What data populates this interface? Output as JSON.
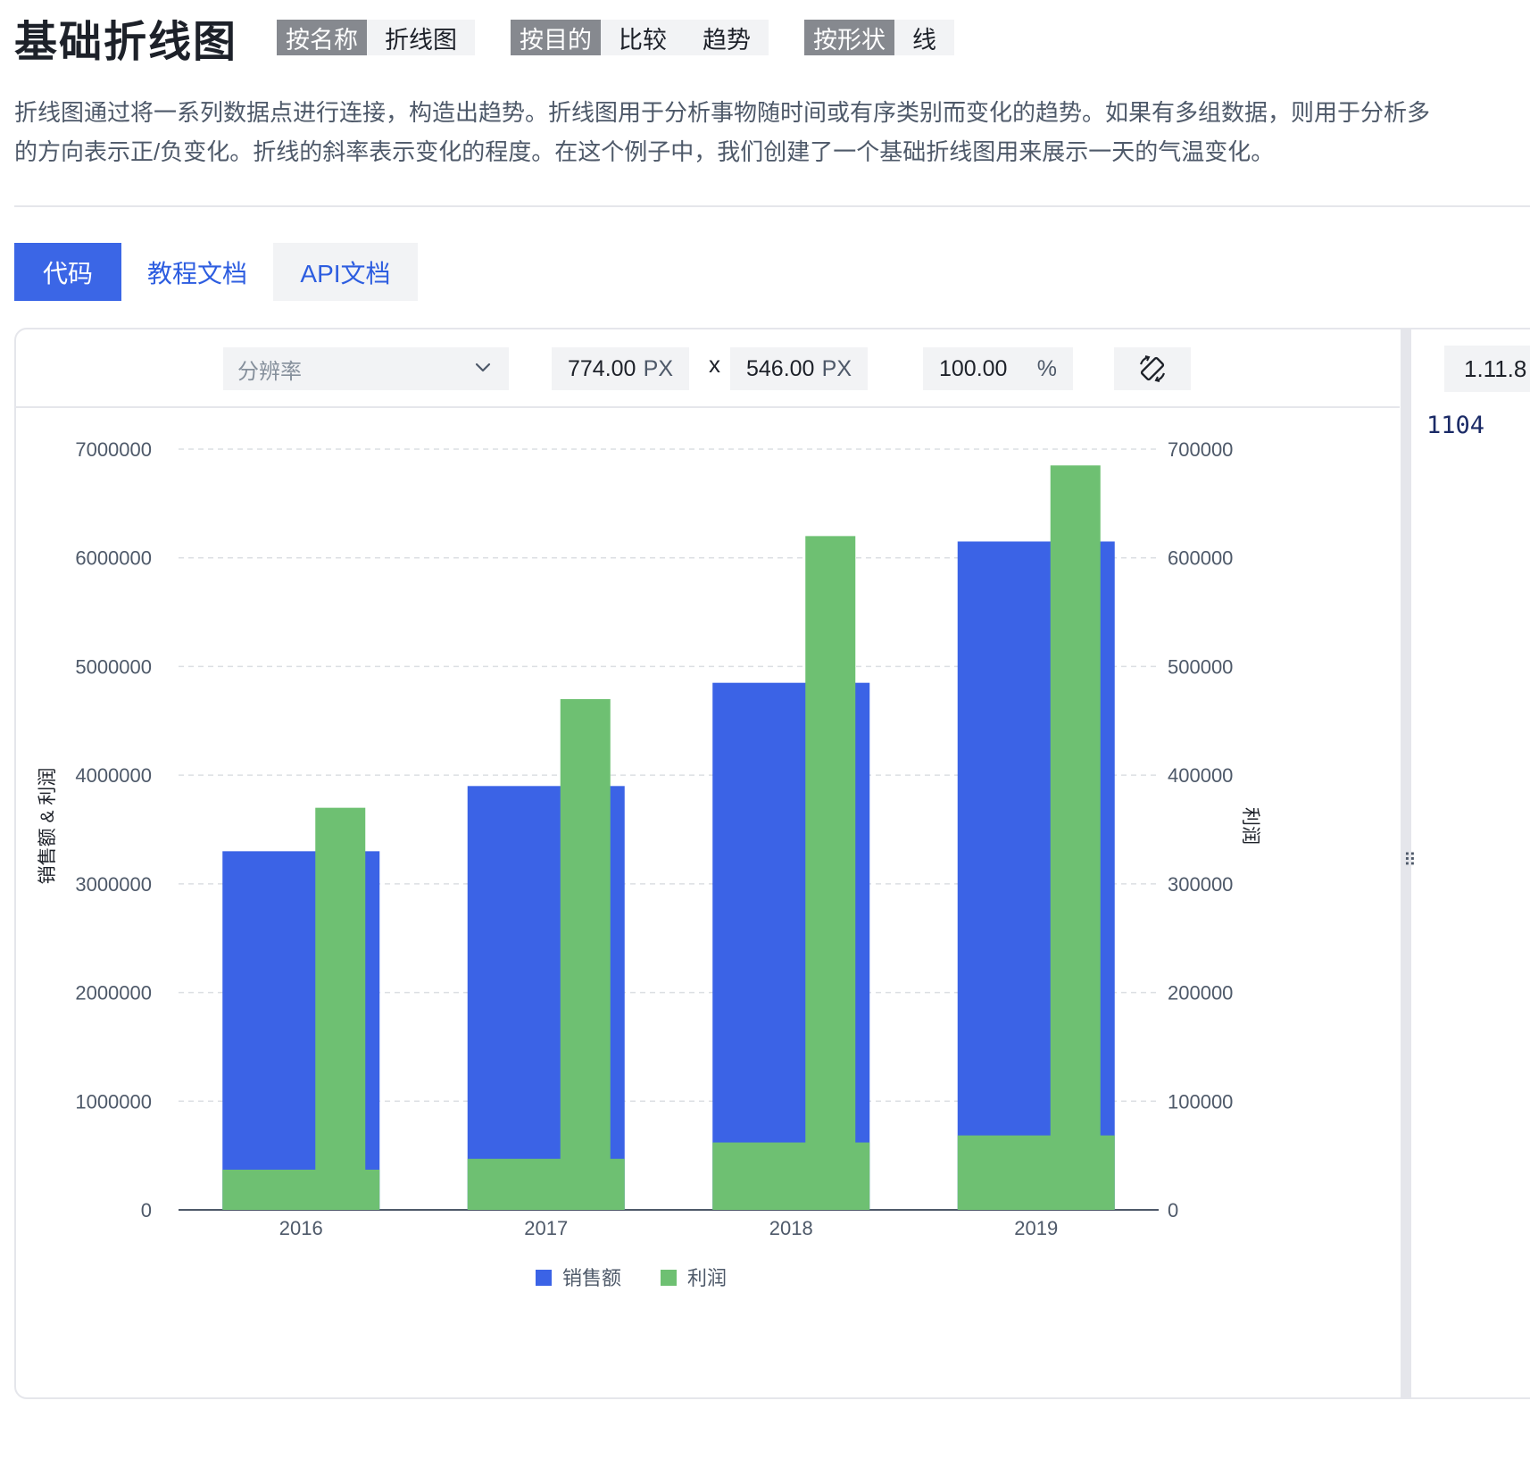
{
  "header": {
    "title": "基础折线图",
    "tags": [
      {
        "key": "按名称",
        "values": [
          "折线图"
        ]
      },
      {
        "key": "按目的",
        "values": [
          "比较",
          "趋势"
        ]
      },
      {
        "key": "按形状",
        "values": [
          "线"
        ]
      }
    ]
  },
  "description": {
    "line1": "折线图通过将一系列数据点进行连接，构造出趋势。折线图用于分析事物随时间或有序类别而变化的趋势。如果有多组数据，则用于分析多",
    "line2": "的方向表示正/负变化。折线的斜率表示变化的程度。在这个例子中，我们创建了一个基础折线图用来展示一天的气温变化。"
  },
  "tabs": {
    "code": "代码",
    "tutorial": "教程文档",
    "api": "API文档"
  },
  "toolbar": {
    "resolution_placeholder": "分辨率",
    "width_value": "774.00",
    "width_unit": "PX",
    "times": "x",
    "height_value": "546.00",
    "height_unit": "PX",
    "zoom_value": "100.00",
    "zoom_unit": "%"
  },
  "editor": {
    "version": "1.11.8",
    "line_text": "1104"
  },
  "colors": {
    "accent": "#3b66e6",
    "sales": "#3b63e6",
    "profit": "#6ec072"
  },
  "chart_data": {
    "type": "bar",
    "categories": [
      "2016",
      "2017",
      "2018",
      "2019"
    ],
    "series": [
      {
        "name": "销售额",
        "axis": "left",
        "values": [
          3300000,
          3900000,
          4850000,
          6150000
        ]
      },
      {
        "name": "利润",
        "axis": "right",
        "values": [
          370000,
          470000,
          620000,
          685000
        ]
      }
    ],
    "left_axis": {
      "label": "销售额 & 利润",
      "ticks": [
        "0",
        "1000000",
        "2000000",
        "3000000",
        "4000000",
        "5000000",
        "6000000",
        "7000000"
      ],
      "ylim": [
        0,
        7000000
      ]
    },
    "right_axis": {
      "label": "利润",
      "ticks": [
        "0",
        "100000",
        "200000",
        "300000",
        "400000",
        "500000",
        "600000",
        "700000"
      ],
      "ylim": [
        0,
        700000
      ]
    },
    "legend": [
      "销售额",
      "利润"
    ],
    "legend_position": "bottom",
    "grid": true
  }
}
